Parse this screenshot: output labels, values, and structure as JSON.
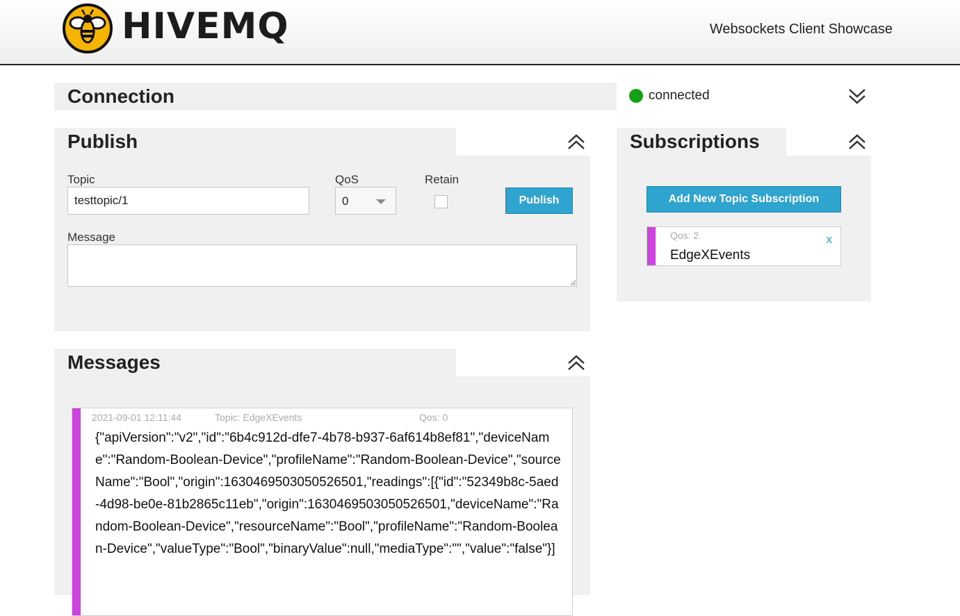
{
  "header": {
    "logo_text": "HIVEMQ",
    "subtitle": "Websockets Client Showcase"
  },
  "connection": {
    "title": "Connection",
    "status": "connected",
    "status_color": "#14a014",
    "toggle_icon": "chevron-double-down-icon"
  },
  "publish": {
    "title": "Publish",
    "topic_label": "Topic",
    "topic_value": "testtopic/1",
    "qos_label": "QoS",
    "qos_value": "0",
    "retain_label": "Retain",
    "retain_checked": false,
    "button_label": "Publish",
    "message_label": "Message",
    "message_value": "",
    "toggle_icon": "chevron-double-up-icon"
  },
  "subscriptions": {
    "title": "Subscriptions",
    "add_button_label": "Add New Topic Subscription",
    "items": [
      {
        "qos": "Qos: 2",
        "topic": "EdgeXEvents",
        "color": "#cc44dd",
        "remove_label": "x"
      }
    ],
    "toggle_icon": "chevron-double-up-icon"
  },
  "messages": {
    "title": "Messages",
    "toggle_icon": "chevron-double-up-icon",
    "items": [
      {
        "timestamp": "2021-09-01 12:11:44",
        "topic": "Topic: EdgeXEvents",
        "qos": "Qos: 0",
        "color": "#cc44dd",
        "payload": "{\"apiVersion\":\"v2\",\"id\":\"6b4c912d-dfe7-4b78-b937-6af614b8ef81\",\"deviceName\":\"Random-Boolean-Device\",\"profileName\":\"Random-Boolean-Device\",\"sourceName\":\"Bool\",\"origin\":1630469503050526501,\"readings\":[{\"id\":\"52349b8c-5aed-4d98-be0e-81b2865c11eb\",\"origin\":1630469503050526501,\"deviceName\":\"Random-Boolean-Device\",\"resourceName\":\"Bool\",\"profileName\":\"Random-Boolean-Device\",\"valueType\":\"Bool\",\"binaryValue\":null,\"mediaType\":\"\",\"value\":\"false\"}]"
      }
    ]
  },
  "colors": {
    "accent": "#2fa4cf",
    "panel": "#f0f0f0",
    "subscription": "#cc44dd"
  }
}
